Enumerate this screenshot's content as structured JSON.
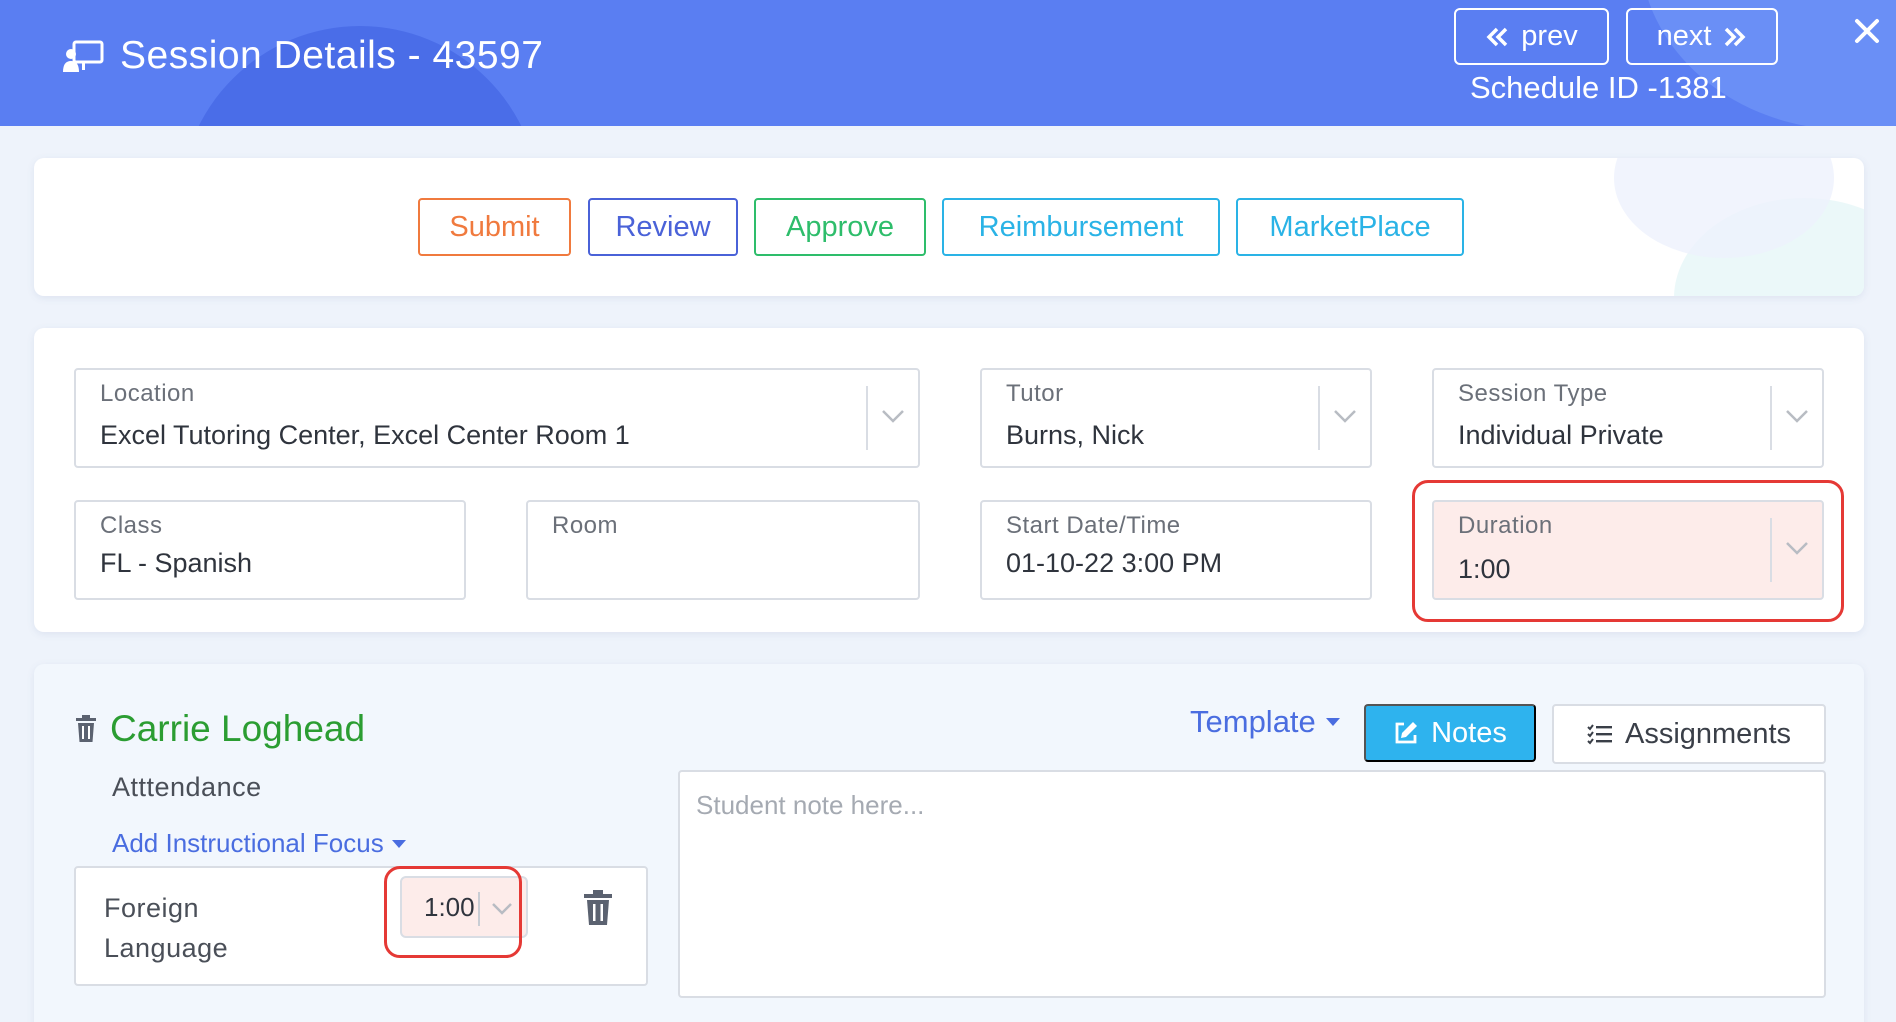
{
  "header": {
    "title": "Session Details - 43597",
    "prev_label": "prev",
    "next_label": "next",
    "schedule_id": "Schedule ID -1381"
  },
  "actions": {
    "submit": "Submit",
    "review": "Review",
    "approve": "Approve",
    "reimbursement": "Reimbursement",
    "marketplace": "MarketPlace"
  },
  "form": {
    "location": {
      "label": "Location",
      "value": "Excel Tutoring Center, Excel Center Room 1"
    },
    "tutor": {
      "label": "Tutor",
      "value": "Burns, Nick"
    },
    "session_type": {
      "label": "Session Type",
      "value": "Individual Private"
    },
    "class": {
      "label": "Class",
      "value": "FL - Spanish"
    },
    "room": {
      "label": "Room",
      "value": ""
    },
    "start": {
      "label": "Start Date/Time",
      "value": "01-10-22 3:00 PM"
    },
    "duration": {
      "label": "Duration",
      "value": "1:00"
    }
  },
  "student": {
    "name": "Carrie Loghead",
    "attendance_label": "Atttendance",
    "add_focus_label": "Add Instructional Focus",
    "focus": {
      "label": "Foreign Language",
      "duration": "1:00"
    },
    "template_label": "Template",
    "notes_label": "Notes",
    "assignments_label": "Assignments",
    "note_placeholder": "Student note here..."
  },
  "colors": {
    "header_bg": "#5a7ef2",
    "submit": "#f07a3e",
    "review": "#4a62d8",
    "approve": "#2ebd6b",
    "info": "#2ab3e6",
    "student_name": "#2b9d32",
    "highlight": "#e53935"
  }
}
